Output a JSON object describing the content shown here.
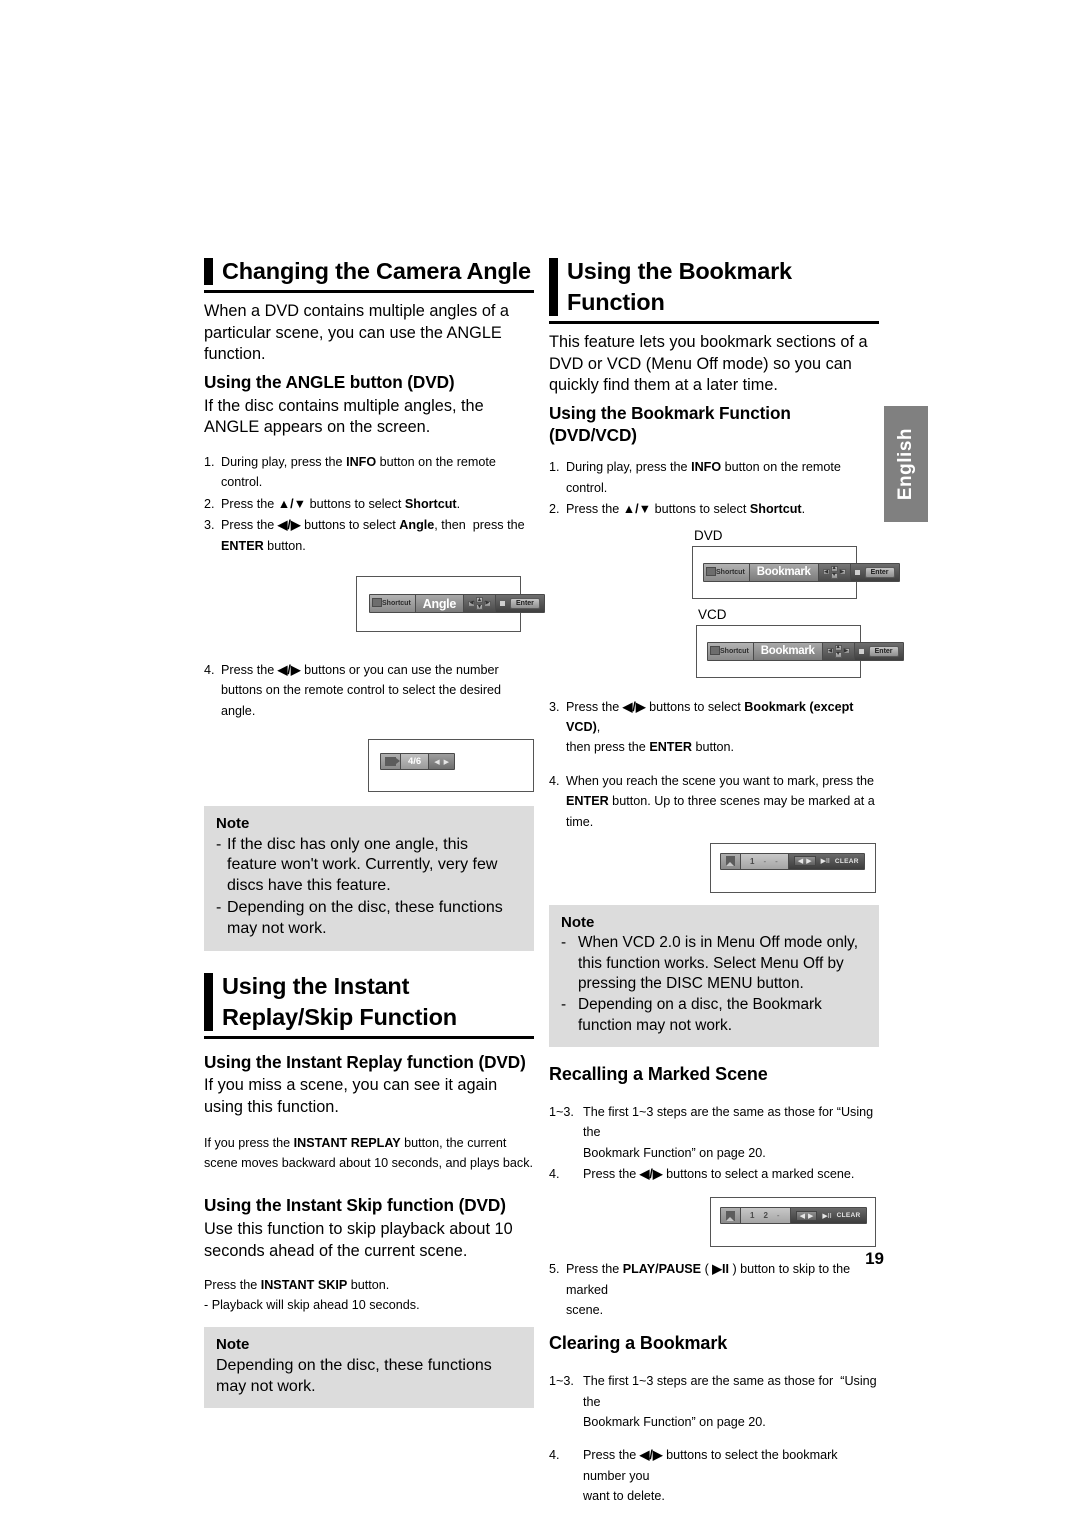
{
  "lang_tab": "English",
  "page_number": "19",
  "left": {
    "section1": {
      "heading": "Changing the Camera Angle",
      "intro": "When a DVD contains multiple angles of a particular scene, you can use the ANGLE function.",
      "sub_head": "Using the ANGLE button (DVD)",
      "sub_body": "If the disc contains multiple angles, the ANGLE appears on the screen.",
      "steps": [
        {
          "num": "1.",
          "text": "During play, press the INFO button on the remote control."
        },
        {
          "num": "2.",
          "text": "Press the ▲/▼ buttons to select Shortcut."
        },
        {
          "num": "3.",
          "text": "Press the ◀/▶ buttons to select Angle, then  press the ENTER button."
        }
      ],
      "osd1": {
        "shortcut_label": "Shortcut",
        "title": "Angle",
        "enter_label": "Enter"
      },
      "step4": {
        "num": "4.",
        "text": "Press the ◀/▶ buttons or you can use the number buttons on the remote control to select the desired angle."
      },
      "osd2": {
        "value": "4/6"
      },
      "note": {
        "title": "Note",
        "items": [
          "If the disc has only one angle, this feature won't work. Currently, very few discs have this feature.",
          "Depending on the disc, these functions may not work."
        ]
      }
    },
    "section2": {
      "heading": "Using the Instant Replay/Skip Function",
      "sub_head1": "Using the Instant Replay function (DVD)",
      "sub_body1": "If you miss a scene, you can see it again using this function.",
      "small1": "If you press the INSTANT REPLAY button, the current scene moves backward about 10 seconds, and plays back.",
      "sub_head2": "Using the Instant Skip function (DVD)",
      "sub_body2": "Use this function to skip playback about 10 seconds ahead of the current scene.",
      "small2": "Press the INSTANT SKIP button.",
      "small3": "- Playback will skip ahead 10 seconds.",
      "note": {
        "title": "Note",
        "text": "Depending on the disc, these functions may not work."
      }
    }
  },
  "right": {
    "section1": {
      "heading": "Using the Bookmark Function",
      "intro": "This feature lets you bookmark sections of a DVD or VCD (Menu Off mode) so you can quickly find them at a later time.",
      "sub_head": "Using the Bookmark Function (DVD/VCD)",
      "steps": [
        {
          "num": "1.",
          "text": "During play, press the INFO button on the remote control."
        },
        {
          "num": "2.",
          "text": "Press the ▲/▼ buttons to select Shortcut."
        }
      ],
      "fig_dvd_label": "DVD",
      "fig_vcd_label": "VCD",
      "osd": {
        "shortcut_label": "Shortcut",
        "title": "Bookmark",
        "enter_label": "Enter"
      },
      "step3": {
        "num": "3.",
        "text": "Press the ◀/▶ buttons to select Bookmark (except VCD), then press the ENTER button."
      },
      "step4": {
        "num": "4.",
        "text": "When you reach the scene you want to mark, press the ENTER button. Up to three scenes may be marked at a time."
      },
      "osd_marks1": {
        "slots": [
          "1",
          "-",
          "-"
        ],
        "clear_label": "CLEAR"
      },
      "note": {
        "title": "Note",
        "items": [
          "When VCD 2.0 is in Menu Off mode only, this function works. Select Menu Off by pressing the DISC MENU button.",
          "Depending on a disc, the Bookmark function may not work."
        ]
      }
    },
    "section2": {
      "heading": "Recalling a Marked Scene",
      "steps": [
        {
          "num": "1~3.",
          "text": "The first 1~3 steps are the same as those for “Using the Bookmark Function” on page 20."
        },
        {
          "num": "4.",
          "text": "Press the ◀/▶ buttons to select a marked scene."
        }
      ],
      "osd_marks2": {
        "slots": [
          "1",
          "2",
          "-"
        ],
        "clear_label": "CLEAR"
      },
      "step5": {
        "num": "5.",
        "text": "Press the PLAY/PAUSE ( ▶II ) button to skip to the marked scene."
      }
    },
    "section3": {
      "heading": "Clearing a Bookmark",
      "steps": [
        {
          "num": "1~3.",
          "text": "The first 1~3 steps are the same as those for  “Using the Bookmark Function” on page 20."
        },
        {
          "num": "4.",
          "text": "Press the ◀/▶ buttons to select the bookmark number you want to delete."
        }
      ]
    }
  }
}
